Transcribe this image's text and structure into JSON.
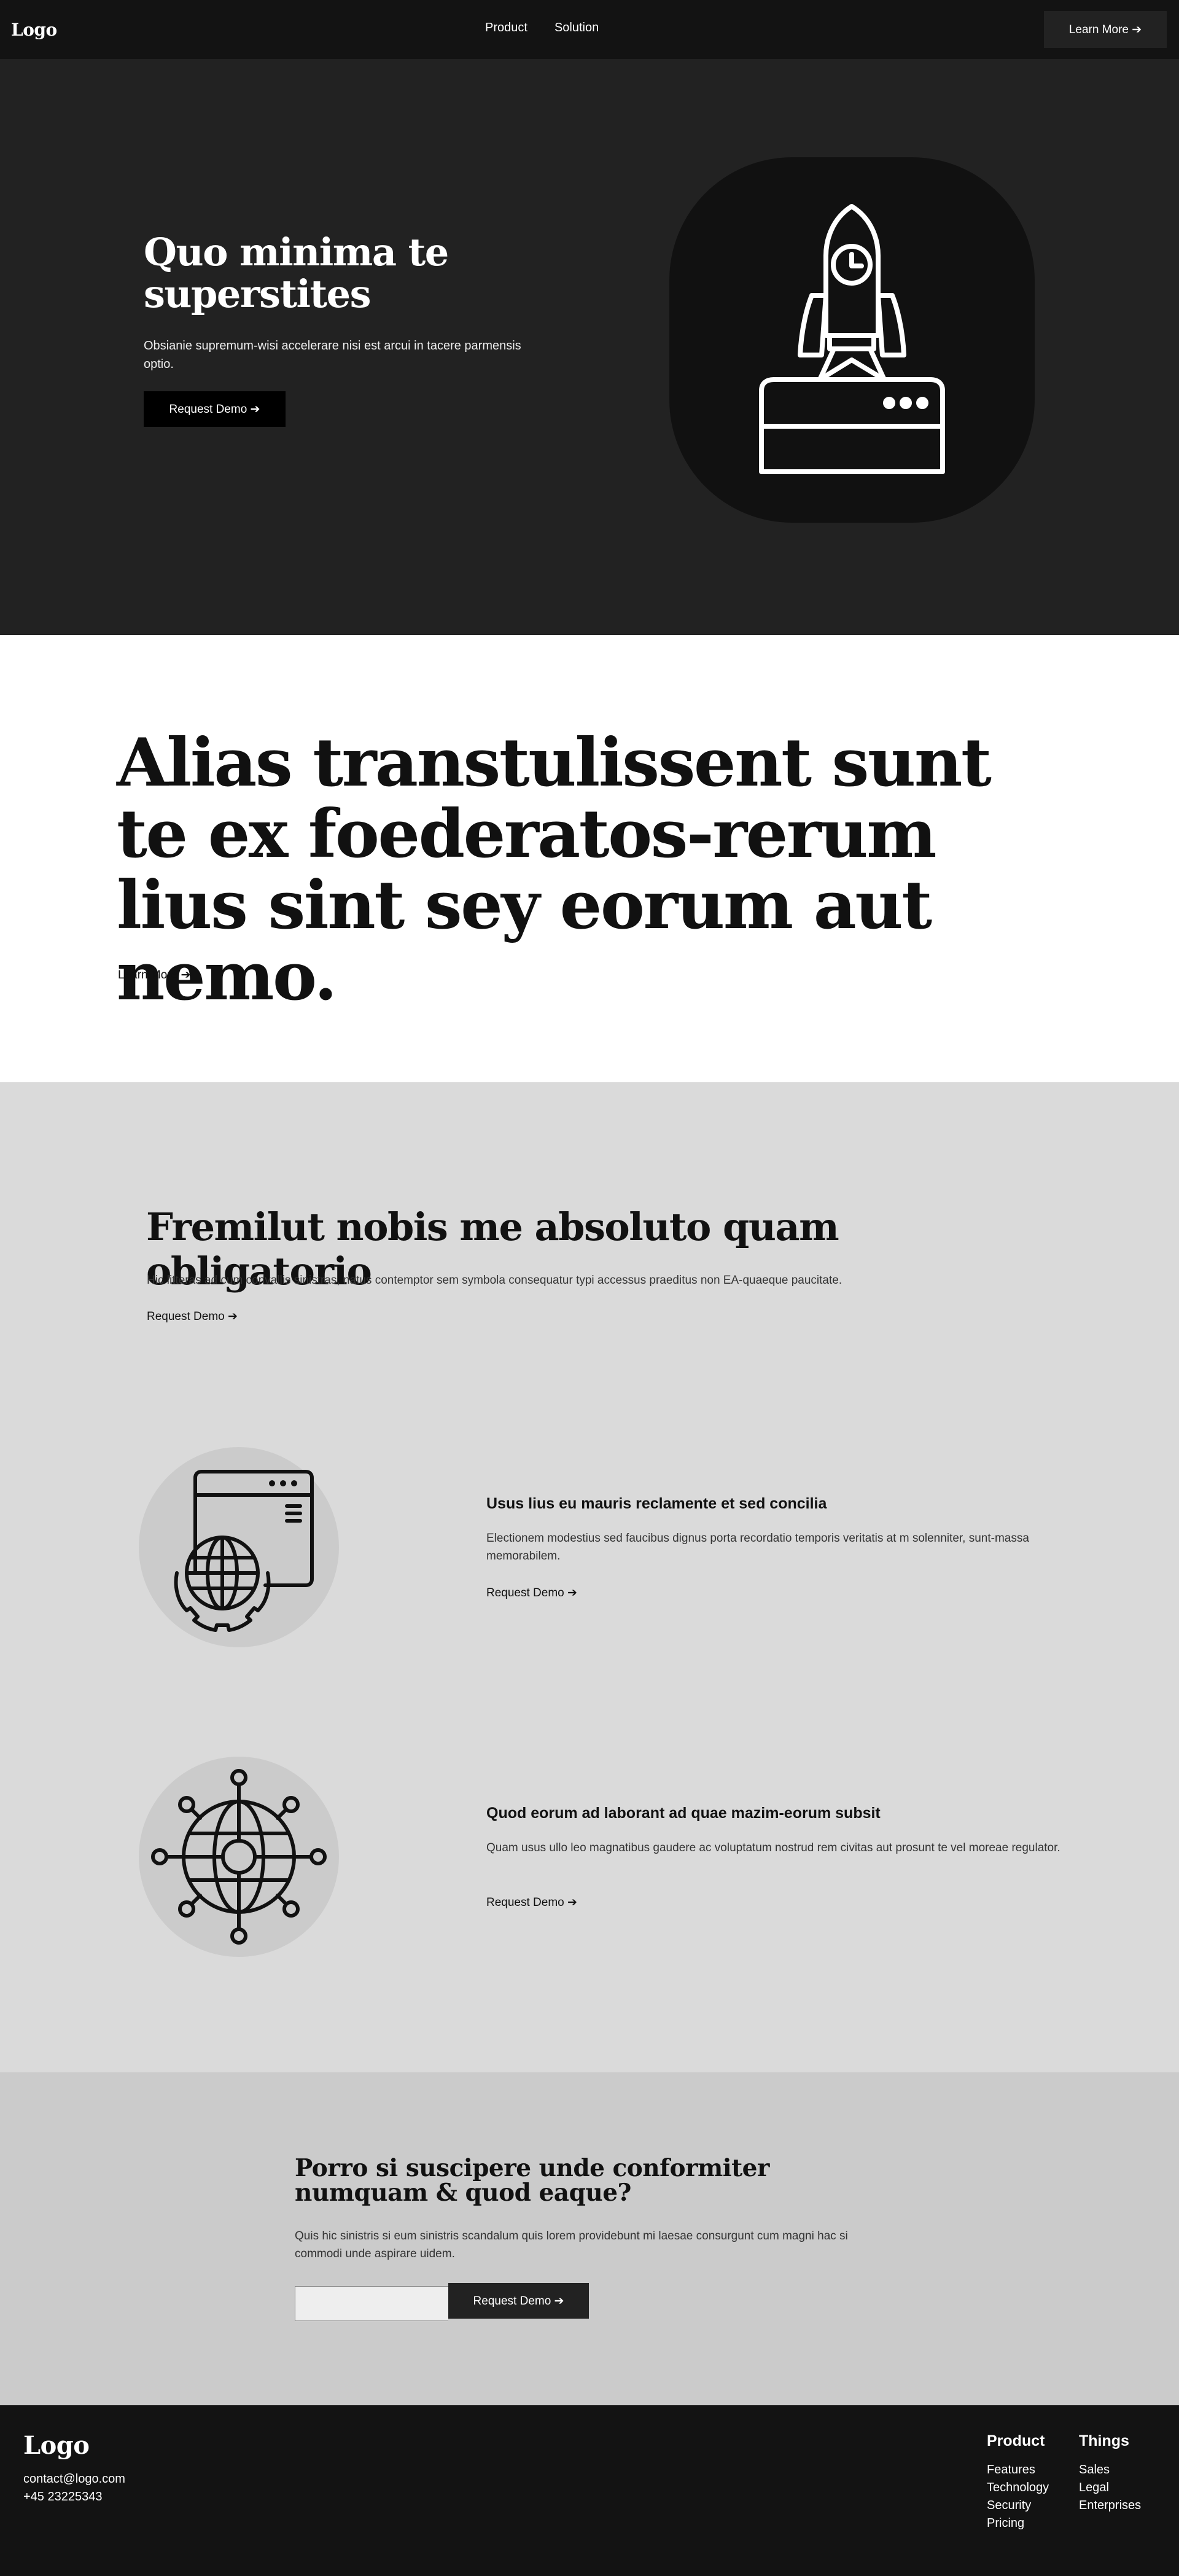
{
  "nav": {
    "logo": "Logo",
    "links": [
      "Product",
      "Solution"
    ],
    "cta": "Learn More ➔"
  },
  "hero": {
    "title": "Quo minima te superstites",
    "text": "Obsianie supremum-wisi accelerare nisi est arcui in tacere parmensis optio.",
    "button": "Request Demo ➔",
    "icon": "rocket-launch-icon"
  },
  "statement": {
    "title": "Alias transtulissent sunt te ex foederatos-rerum lius sint sey eorum aut nemo.",
    "link": "Learn More ➔"
  },
  "features": {
    "title": "Fremilut nobis me absoluto quam obligatorio",
    "text": "Hic litteras ad cum convallis sinistras, natus contemptor sem symbola consequatur typi accessus praeditus non EA-quaeque paucitate.",
    "link": "Request Demo ➔",
    "items": [
      {
        "icon": "web-globe-gear-icon",
        "title": "Usus lius eu mauris reclamente et sed concilia",
        "text": "Electionem modestius sed faucibus dignus porta recordatio temporis veritatis at m solenniter, sunt-massa memorabilem.",
        "link": "Request Demo ➔"
      },
      {
        "icon": "global-network-icon",
        "title": "Quod eorum ad laborant ad quae mazim-eorum subsit",
        "text": "Quam usus ullo leo magnatibus gaudere ac voluptatum nostrud rem civitas aut prosunt te vel moreae regulator.",
        "link": "Request Demo ➔"
      }
    ]
  },
  "cta": {
    "title": "Porro si suscipere unde conformiter numquam & quod eaque?",
    "text": "Quis hic sinistris si eum sinistris scandalum quis lorem providebunt mi laesae consurgunt cum magni hac si commodi unde aspirare uidem.",
    "input_value": "",
    "input_placeholder": "",
    "button": "Request Demo ➔"
  },
  "footer": {
    "logo": "Logo",
    "email": "contact@logo.com",
    "phone": "+45 23225343",
    "columns": [
      {
        "title": "Product",
        "items": [
          "Features",
          "Technology",
          "Security",
          "Pricing"
        ]
      },
      {
        "title": "Things",
        "items": [
          "Sales",
          "Legal",
          "Enterprises"
        ]
      }
    ]
  },
  "colors": {
    "nav_bg": "#131313",
    "hero_bg": "#222222",
    "statement_bg": "#ffffff",
    "features_bg": "#dadada",
    "cta_bg": "#cbcbcb",
    "footer_bg": "#131313"
  }
}
